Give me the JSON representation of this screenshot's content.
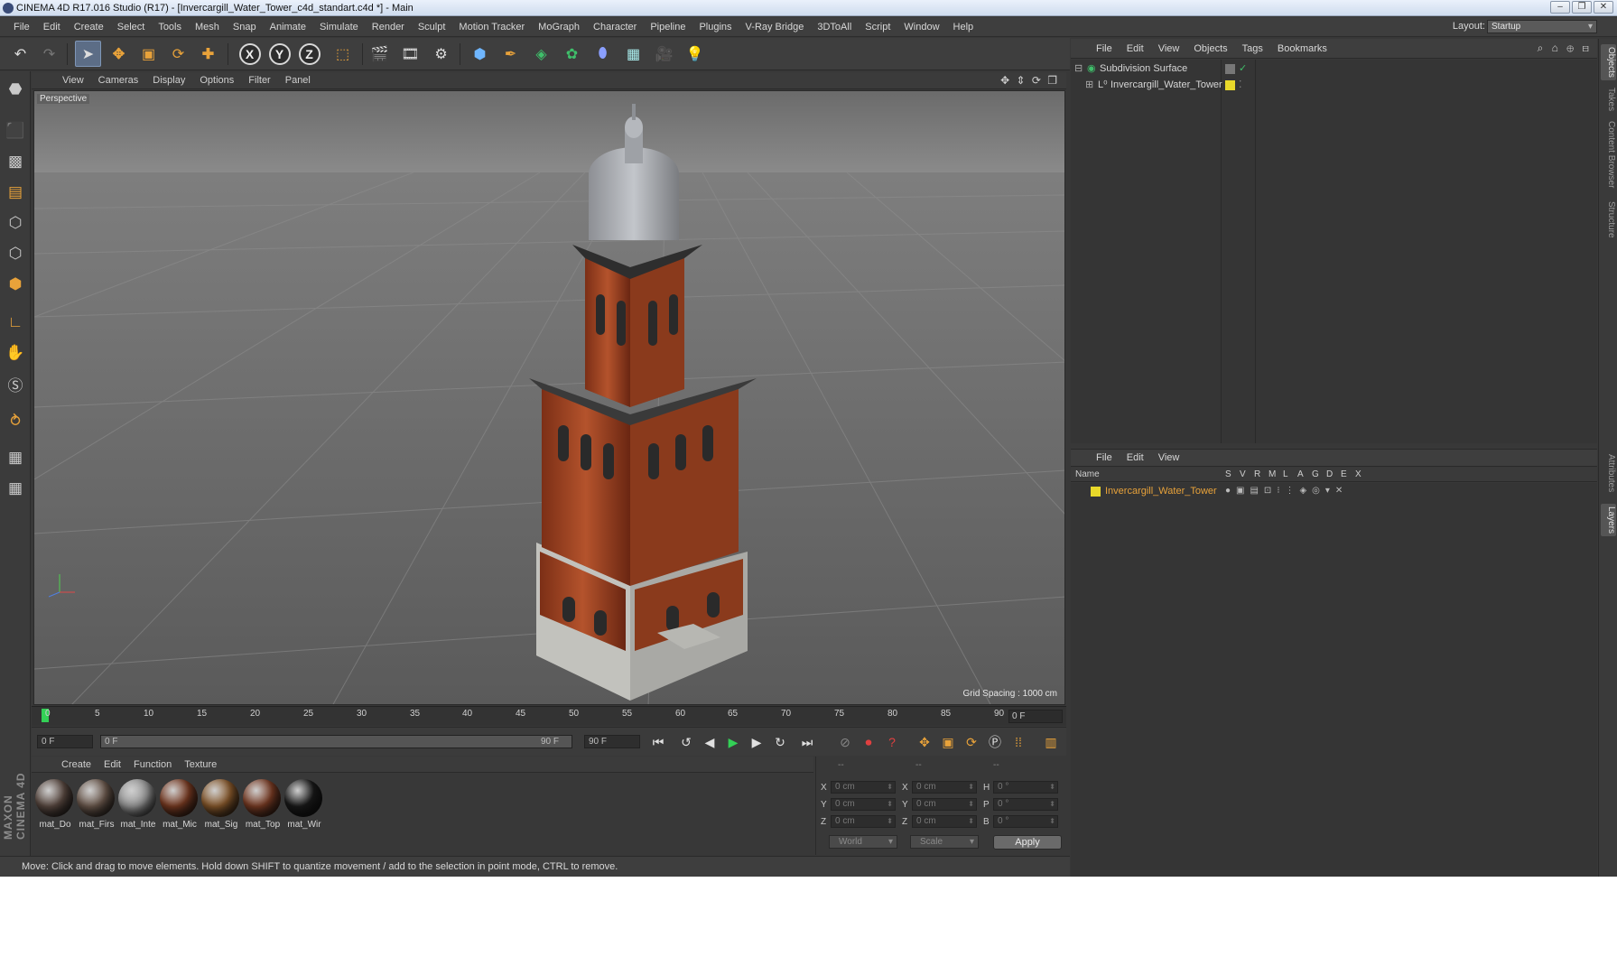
{
  "window": {
    "title": "CINEMA 4D R17.016 Studio (R17) - [Invercargill_Water_Tower_c4d_standart.c4d *] - Main",
    "controls": [
      "–",
      "❐",
      "✕"
    ]
  },
  "menubar": {
    "items": [
      "File",
      "Edit",
      "Create",
      "Select",
      "Tools",
      "Mesh",
      "Snap",
      "Animate",
      "Simulate",
      "Render",
      "Sculpt",
      "Motion Tracker",
      "MoGraph",
      "Character",
      "Pipeline",
      "Plugins",
      "V-Ray Bridge",
      "3DToAll",
      "Script",
      "Window",
      "Help"
    ],
    "layout_label": "Layout:",
    "layout_value": "Startup"
  },
  "toolbar": {
    "icons": [
      "undo-icon",
      "redo-icon",
      "select-arrow-icon",
      "move-icon",
      "scale-icon",
      "rotate-icon",
      "live-select-icon",
      "x-axis-icon",
      "y-axis-icon",
      "z-axis-icon",
      "world-coords-icon",
      "render-view-icon",
      "render-picture-viewer-icon",
      "render-settings-icon",
      "cube-primitive-icon",
      "pen-spline-icon",
      "subdivision-icon",
      "cloner-icon",
      "deformer-icon",
      "floor-icon",
      "camera-icon",
      "light-icon"
    ],
    "axis_labels": [
      "X",
      "Y",
      "Z"
    ]
  },
  "viewport": {
    "menu": [
      "View",
      "Cameras",
      "Display",
      "Options",
      "Filter",
      "Panel"
    ],
    "label": "Perspective",
    "grid_spacing": "Grid Spacing : 1000 cm",
    "nav_icons": "✥ ⇕ ⟳ ❐"
  },
  "timeline": {
    "ticks": [
      "0",
      "5",
      "10",
      "15",
      "20",
      "25",
      "30",
      "35",
      "40",
      "45",
      "50",
      "55",
      "60",
      "65",
      "70",
      "75",
      "80",
      "85",
      "90"
    ],
    "current_frame": "0 F",
    "start_field": "0 F",
    "range_start": "0 F",
    "range_end": "90 F",
    "end_field": "90 F"
  },
  "materials": {
    "menu": [
      "Create",
      "Edit",
      "Function",
      "Texture"
    ],
    "items": [
      {
        "name": "mat_Do",
        "color": "#5b4a42"
      },
      {
        "name": "mat_Firs",
        "color": "#6d5a4e"
      },
      {
        "name": "mat_Inte",
        "color": "#9a9a9a"
      },
      {
        "name": "mat_Mic",
        "color": "#7a3b22"
      },
      {
        "name": "mat_Sig",
        "color": "#8a5a2c"
      },
      {
        "name": "mat_Top",
        "color": "#7b3c24"
      },
      {
        "name": "mat_Wir",
        "color": "#1a1a1a"
      }
    ]
  },
  "coords": {
    "headers": [
      "--",
      "--",
      "--"
    ],
    "rows": [
      {
        "axis": "X",
        "pos": "0 cm",
        "axis2": "X",
        "size": "0 cm",
        "rot_label": "H",
        "rot": "0 °"
      },
      {
        "axis": "Y",
        "pos": "0 cm",
        "axis2": "Y",
        "size": "0 cm",
        "rot_label": "P",
        "rot": "0 °"
      },
      {
        "axis": "Z",
        "pos": "0 cm",
        "axis2": "Z",
        "size": "0 cm",
        "rot_label": "B",
        "rot": "0 °"
      }
    ],
    "mode": "World",
    "transform": "Scale",
    "apply": "Apply"
  },
  "status": {
    "text": "Move: Click and drag to move elements. Hold down SHIFT to quantize movement / add to the selection in point mode, CTRL to remove."
  },
  "objects_panel": {
    "menu": [
      "File",
      "Edit",
      "View",
      "Objects",
      "Tags",
      "Bookmarks"
    ],
    "tree": [
      {
        "name": "Subdivision Surface",
        "icon": "subdivision-icon",
        "color": "#3fbf6a"
      },
      {
        "name": "Invercargill_Water_Tower",
        "icon": "null-object-icon",
        "color": "#e8d82a"
      }
    ]
  },
  "layers_panel": {
    "menu": [
      "File",
      "Edit",
      "View"
    ],
    "columns": [
      "Name",
      "S",
      "V",
      "R",
      "M",
      "L",
      "A",
      "G",
      "D",
      "E",
      "X"
    ],
    "rows": [
      {
        "name": "Invercargill_Water_Tower",
        "color": "#e8d82a"
      }
    ]
  },
  "side_tabs": [
    "Objects",
    "Takes",
    "Content Browser",
    "Structure",
    "Attributes",
    "Layers"
  ],
  "brand": "MAXON CINEMA 4D",
  "colors": {
    "accent_orange": "#e8a23a",
    "selection_blue": "#5c6d86",
    "layer_yellow": "#e8d82a",
    "playhead_green": "#33d056"
  }
}
